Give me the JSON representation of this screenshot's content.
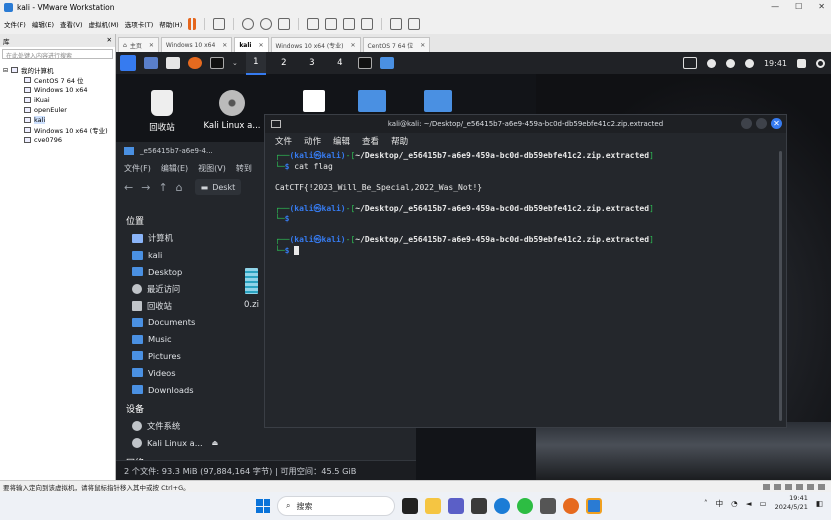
{
  "window": {
    "title": "kali - VMware Workstation",
    "controls": [
      "—",
      "☐",
      "✕"
    ]
  },
  "menu": [
    "文件(F)",
    "编辑(E)",
    "查看(V)",
    "虚拟机(M)",
    "选项卡(T)",
    "帮助(H)"
  ],
  "library": {
    "header": "库",
    "close": "✕",
    "search_placeholder": "在此处键入内容进行搜索",
    "root": "我的计算机",
    "items": [
      "CentOS 7 64 位",
      "Windows 10 x64",
      "iKuai",
      "openEuler",
      "kali",
      "Windows 10 x64 (专业)",
      "cve0796"
    ],
    "selected": "kali"
  },
  "tabs": [
    {
      "label": "主页",
      "active": false
    },
    {
      "label": "Windows 10 x64",
      "active": false
    },
    {
      "label": "kali",
      "active": true
    },
    {
      "label": "Windows 10 x64 (专业)",
      "active": false
    },
    {
      "label": "CentOS 7 64 位",
      "active": false
    }
  ],
  "kali_panel": {
    "workspaces": [
      "1",
      "2",
      "3",
      "4"
    ],
    "active_workspace": "1",
    "clock": "19:41"
  },
  "desktop_icons": [
    {
      "label": "回收站",
      "icon": "trash-icon"
    },
    {
      "label": "Kali Linux a...",
      "icon": "disc-icon"
    }
  ],
  "file_manager": {
    "title": "_e56415b7-a6e9-4...",
    "menu": [
      "文件(F)",
      "编辑(E)",
      "视图(V)",
      "转到"
    ],
    "path": "Deskt",
    "sections": [
      {
        "header": "位置",
        "items": [
          {
            "label": "计算机",
            "icon": "computer-icon"
          },
          {
            "label": "kali",
            "icon": "home-folder-icon"
          },
          {
            "label": "Desktop",
            "icon": "folder-icon"
          },
          {
            "label": "最近访问",
            "icon": "recent-icon"
          },
          {
            "label": "回收站",
            "icon": "trash-icon"
          },
          {
            "label": "Documents",
            "icon": "folder-icon"
          },
          {
            "label": "Music",
            "icon": "folder-icon"
          },
          {
            "label": "Pictures",
            "icon": "folder-icon"
          },
          {
            "label": "Videos",
            "icon": "folder-icon"
          },
          {
            "label": "Downloads",
            "icon": "folder-icon"
          }
        ]
      },
      {
        "header": "设备",
        "items": [
          {
            "label": "文件系统",
            "icon": "disk-icon"
          },
          {
            "label": "Kali Linux a...",
            "icon": "disc-icon"
          }
        ]
      },
      {
        "header": "网络",
        "items": []
      }
    ],
    "file": "0.zi",
    "status": "2 个文件: 93.3 MiB (97,884,164 字节) | 可用空间：45.5 GiB"
  },
  "terminal": {
    "title": "kali@kali: ~/Desktop/_e56415b7-a6e9-459a-bc0d-db59ebfe41c2.zip.extracted",
    "menu": [
      "文件",
      "动作",
      "编辑",
      "查看",
      "帮助"
    ],
    "prompt_user": "(kali㉿kali)",
    "prompt_path": "~/Desktop/_e56415b7-a6e9-459a-bc0d-db59ebfe41c2.zip.extracted",
    "command": "cat flag",
    "output": "CatCTF{!2023_Will_Be_Special,2022_Was_Not!}"
  },
  "vm_status": "要将输入定向到该虚拟机，请将鼠标指针移入其中或按 Ctrl+G。",
  "taskbar": {
    "search_placeholder": "搜索",
    "ime": "中",
    "time": "19:41",
    "date": "2024/5/21"
  },
  "colors": {
    "kali_blue": "#367bf0",
    "prompt_green": "#2fbf55",
    "terminal_bg": "#24272c"
  }
}
